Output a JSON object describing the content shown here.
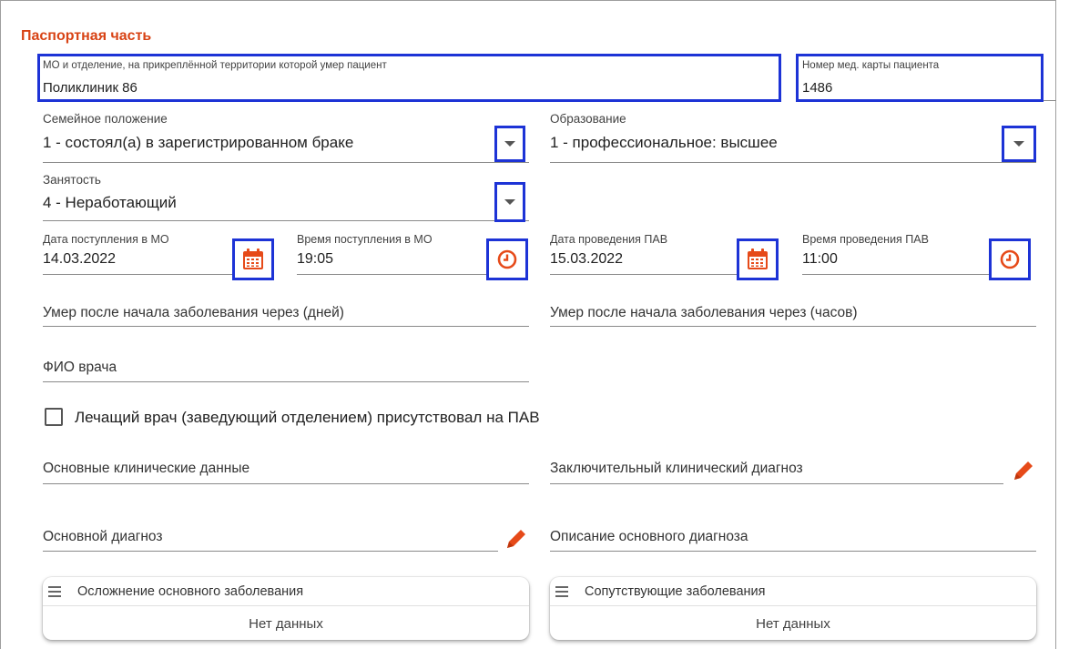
{
  "section": {
    "title": "Паспортная часть"
  },
  "fields": {
    "mo": {
      "label": "МО и отделение, на прикреплённой территории которой умер пациент",
      "value": "Поликлиник 86"
    },
    "card": {
      "label": "Номер мед. карты пациента",
      "value": "1486"
    },
    "family": {
      "label": "Семейное положение",
      "value": "1 - состоял(а) в зарегистрированном браке"
    },
    "education": {
      "label": "Образование",
      "value": "1 - профессиональное: высшее"
    },
    "employment": {
      "label": "Занятость",
      "value": "4 - Неработающий"
    },
    "admit_date": {
      "label": "Дата поступления в МО",
      "value": "14.03.2022"
    },
    "admit_time": {
      "label": "Время поступления в МО",
      "value": "19:05"
    },
    "pav_date": {
      "label": "Дата проведения ПАВ",
      "value": "15.03.2022"
    },
    "pav_time": {
      "label": "Время проведения ПАВ",
      "value": "11:00"
    },
    "died_days": {
      "placeholder": "Умер после начала заболевания через (дней)"
    },
    "died_hours": {
      "placeholder": "Умер после начала заболевания через (часов)"
    },
    "doctor": {
      "placeholder": "ФИО врача"
    },
    "attending": {
      "label": "Лечащий врач (заведующий отделением) присутствовал на ПАВ",
      "checked": false
    },
    "clinical_data": {
      "placeholder": "Основные клинические данные"
    },
    "final_diagnosis": {
      "placeholder": "Заключительный клинический диагноз"
    },
    "main_diagnosis": {
      "placeholder": "Основной диагноз"
    },
    "main_diagnosis_desc": {
      "placeholder": "Описание основного диагноза"
    }
  },
  "panels": {
    "complications": {
      "title": "Осложнение основного заболевания",
      "empty": "Нет данных"
    },
    "comorbid": {
      "title": "Сопутствующие заболевания",
      "empty": "Нет данных"
    }
  },
  "icons": {
    "dropdown": "chevron-down-icon",
    "date": "calendar-icon",
    "time": "clock-icon",
    "edit": "pencil-icon",
    "menu": "hamburger-menu-icon"
  },
  "colors": {
    "title": "#d84315",
    "highlight": "#1d33d6",
    "icon": "#e64a19"
  }
}
